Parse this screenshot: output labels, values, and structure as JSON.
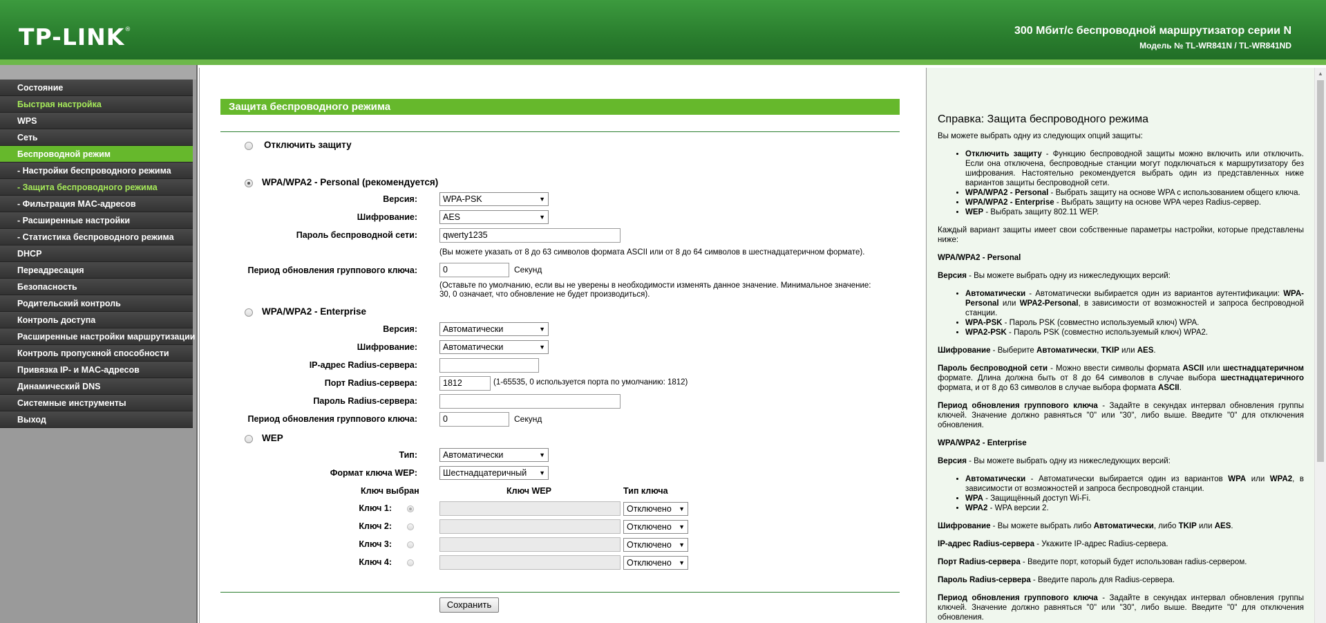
{
  "header": {
    "logo": "TP-LINK",
    "logo_mark": "®",
    "product_title": "300 Мбит/с беспроводной маршрутизатор серии N",
    "product_model": "Модель № TL-WR841N / TL-WR841ND"
  },
  "sidebar": {
    "items": [
      {
        "label": "Состояние"
      },
      {
        "label": "Быстрая настройка"
      },
      {
        "label": "WPS"
      },
      {
        "label": "Сеть"
      },
      {
        "label": "Беспроводной режим"
      },
      {
        "label": "- Настройки беспроводного режима"
      },
      {
        "label": "- Защита беспроводного режима"
      },
      {
        "label": "- Фильтрация MAC-адресов"
      },
      {
        "label": "- Расширенные настройки"
      },
      {
        "label": "- Статистика беспроводного режима"
      },
      {
        "label": "DHCP"
      },
      {
        "label": "Переадресация"
      },
      {
        "label": "Безопасность"
      },
      {
        "label": "Родительский контроль"
      },
      {
        "label": "Контроль доступа"
      },
      {
        "label": "Расширенные настройки маршрутизации"
      },
      {
        "label": "Контроль пропускной способности"
      },
      {
        "label": "Привязка IP- и MAC-адресов"
      },
      {
        "label": "Динамический DNS"
      },
      {
        "label": "Системные инструменты"
      },
      {
        "label": "Выход"
      }
    ]
  },
  "main": {
    "title": "Защита беспроводного режима",
    "disable": {
      "label": "Отключить защиту"
    },
    "personal": {
      "label": "WPA/WPA2 - Personal (рекомендуется)",
      "version_label": "Версия:",
      "version_value": "WPA-PSK",
      "encryption_label": "Шифрование:",
      "encryption_value": "AES",
      "password_label": "Пароль беспроводной сети:",
      "password_value": "qwerty1235",
      "password_hint": "(Вы можете указать от 8 до 63 символов формата ASCII или от 8 до 64 символов в шестнадцатеричном формате).",
      "period_label": "Период обновления группового ключа:",
      "period_value": "0",
      "period_unit": "Секунд",
      "period_hint_1": "(Оставьте по умолчанию, если вы не уверены в необходимости изменять данное значение. Минимальное значение:",
      "period_hint_2": "30, 0 означает, что обновление не будет производиться)."
    },
    "enterprise": {
      "label": "WPA/WPA2 - Enterprise",
      "version_label": "Версия:",
      "version_value": "Автоматически",
      "encryption_label": "Шифрование:",
      "encryption_value": "Автоматически",
      "radius_ip_label": "IP-адрес Radius-сервера:",
      "radius_ip_value": "",
      "radius_port_label": "Порт Radius-сервера:",
      "radius_port_value": "1812",
      "radius_port_hint": "(1-65535, 0 используется порта по умолчанию: 1812)",
      "radius_pass_label": "Пароль Radius-сервера:",
      "radius_pass_value": "",
      "period_label": "Период обновления группового ключа:",
      "period_value": "0",
      "period_unit": "Секунд"
    },
    "wep": {
      "label": "WEP",
      "type_label": "Тип:",
      "type_value": "Автоматически",
      "format_label": "Формат ключа WEP:",
      "format_value": "Шестнадцатеричный",
      "col_selected": "Ключ выбран",
      "col_key": "Ключ WEP",
      "col_type": "Тип ключа",
      "keys": [
        {
          "label": "Ключ 1:",
          "value": "",
          "type": "Отключено"
        },
        {
          "label": "Ключ 2:",
          "value": "",
          "type": "Отключено"
        },
        {
          "label": "Ключ 3:",
          "value": "",
          "type": "Отключено"
        },
        {
          "label": "Ключ 4:",
          "value": "",
          "type": "Отключено"
        }
      ]
    },
    "save_label": "Сохранить"
  },
  "help": {
    "title": "Справка: Защита беспроводного режима",
    "intro": "Вы можете выбрать одну из следующих опций защиты:",
    "opt1_h": "Отключить защиту",
    "opt1_t": " - Функцию беспроводной защиты можно включить или отключить. Если она отключена, беспроводные станции могут подключаться к маршрутизатору без шифрования. Настоятельно рекомендуется выбрать один из представленных ниже вариантов защиты беспроводной сети.",
    "opt2_h": "WPA/WPA2 - Personal",
    "opt2_t": " - Выбрать защиту на основе WPA с использованием общего ключа.",
    "opt3_h": "WPA/WPA2 - Enterprise",
    "opt3_t": " - Выбрать защиту на основе WPA через Radius-сервер.",
    "opt4_h": "WEP",
    "opt4_t": " - Выбрать защиту 802.11 WEP.",
    "each": "Каждый вариант защиты имеет свои собственные параметры настройки, которые представлены ниже:",
    "personal_h": "WPA/WPA2 - Personal",
    "ver_h": "Версия",
    "ver_t": " - Вы можете выбрать одну из нижеследующих версий:",
    "p_auto_h": "Автоматически",
    "p_auto_t1": " - Автоматически выбирается один из вариантов аутентификации: ",
    "p_auto_b1": "WPA-Personal",
    "p_auto_t2": " или ",
    "p_auto_b2": "WPA2-Personal",
    "p_auto_t3": ", в зависимости от возможностей и запроса беспроводной станции.",
    "p_psk_h": "WPA-PSK",
    "p_psk_t": " - Пароль PSK (совместно используемый ключ) WPA.",
    "p_psk2_h": "WPA2-PSK",
    "p_psk2_t": " - Пароль PSK (совместно используемый ключ) WPA2.",
    "enc_h": "Шифрование",
    "enc_t1": " - Выберите ",
    "enc_b1": "Автоматически",
    "enc_t2": ", ",
    "enc_b2": "TKIP",
    "enc_t3": " или ",
    "enc_b3": "AES",
    "enc_t4": ".",
    "pass_h": "Пароль беспроводной сети",
    "pass_t1": " - Можно ввести символы формата ",
    "pass_b1": "ASCII",
    "pass_t2": " или ",
    "pass_b2": "шестнадцатеричном",
    "pass_t3": " формате. Длина должна быть от 8 до 64 символов в случае выбора ",
    "pass_b3": "шестнадцатеричного",
    "pass_t4": " формата, и от 8 до 63 символов в случае выбора формата ",
    "pass_b4": "ASCII",
    "pass_t5": ".",
    "period_h": "Период обновления группового ключа",
    "period_t": " - Задайте в секундах интервал обновления группы ключей. Значение должно равняться \"0\" или \"30\", либо выше. Введите \"0\" для отключения обновления.",
    "ent_h": "WPA/WPA2 - Enterprise",
    "ent_ver_h": "Версия",
    "ent_ver_t": " - Вы можете выбрать одну из нижеследующих версий:",
    "e_auto_h": "Автоматически",
    "e_auto_t1": " - Автоматически выбирается один из вариантов ",
    "e_auto_b1": "WPA",
    "e_auto_t2": " или ",
    "e_auto_b2": "WPA2",
    "e_auto_t3": ", в зависимости от возможностей и запроса беспроводной станции.",
    "e_wpa_h": "WPA",
    "e_wpa_t": " - Защищённый доступ Wi-Fi.",
    "e_wpa2_h": "WPA2",
    "e_wpa2_t": " - WPA версии 2.",
    "ent_enc_h": "Шифрование",
    "ent_enc_t1": " - Вы можете выбрать либо ",
    "ent_enc_b1": "Автоматически",
    "ent_enc_t2": ", либо ",
    "ent_enc_b2": "TKIP",
    "ent_enc_t3": " или ",
    "ent_enc_b3": "AES",
    "ent_enc_t4": ".",
    "rip_h": "IP-адрес Radius-сервера",
    "rip_t": " - Укажите IP-адрес Radius-сервера.",
    "rport_h": "Порт Radius-сервера",
    "rport_t": " - Введите порт, который будет использован radius-сервером.",
    "rpass_h": "Пароль Radius-сервера",
    "rpass_t": " - Введите пароль для Radius-сервера.",
    "rperiod_h": "Период обновления группового ключа",
    "rperiod_t": " - Задайте в секундах интервал обновления группы ключей. Значение должно равняться \"0\" или \"30\", либо выше. Введите \"0\" для отключения обновления."
  },
  "colors": {
    "accent_green": "#66b82c",
    "header_green": "#2a7e2e",
    "menu_highlight": "#a6ea5a"
  }
}
